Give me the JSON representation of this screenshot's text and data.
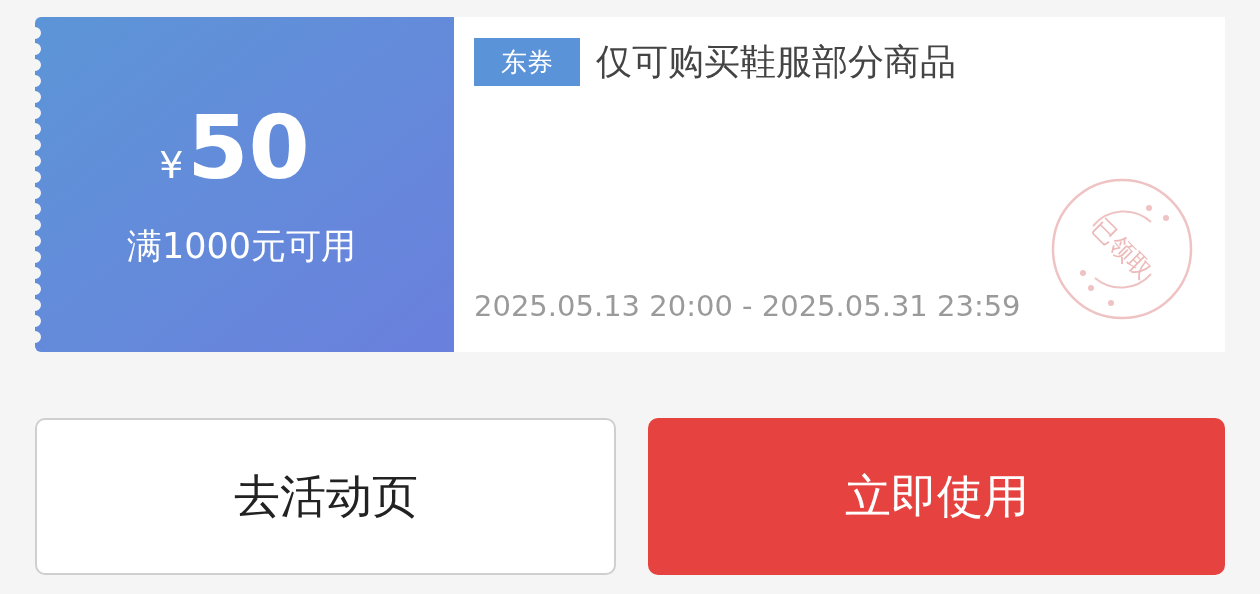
{
  "coupon": {
    "currency": "¥",
    "amount": "50",
    "condition": "满1000元可用",
    "tag": "东券",
    "title": "仅可购买鞋服部分商品",
    "validity": "2025.05.13 20:00 - 2025.05.31 23:59",
    "stamp": "已领取"
  },
  "buttons": [
    {
      "label": "去活动页",
      "kind": "secondary"
    },
    {
      "label": "立即使用",
      "kind": "primary"
    }
  ]
}
